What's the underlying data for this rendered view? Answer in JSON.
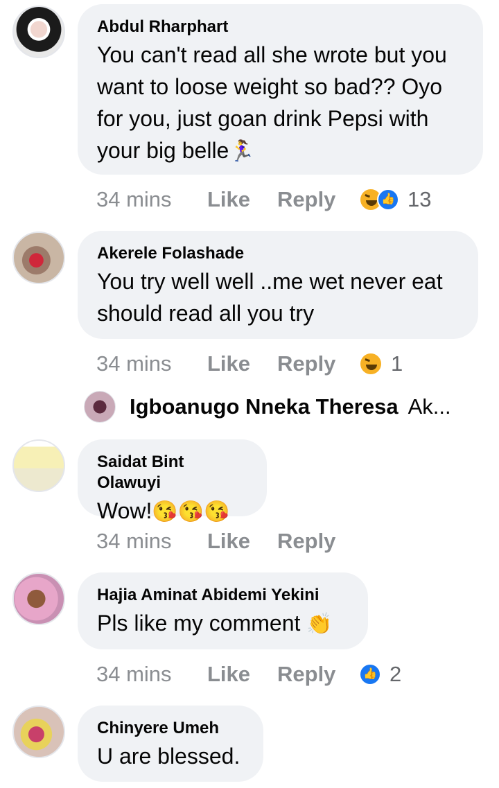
{
  "comments": [
    {
      "name": "Abdul Rharphart",
      "text": "You can't read all she wrote but you\nwant to loose weight so bad?? Oyo\nfor you, just goan drink Pepsi with\nyour big belle",
      "emoji": "🏃‍♀️",
      "time": "34 mins",
      "like": "Like",
      "reply": "Reply",
      "reaction_count": "13",
      "reactions": [
        "laugh",
        "like"
      ]
    },
    {
      "name": "Akerele Folashade",
      "text": "You try well well ..me wet never eat\nshould read all you try",
      "time": "34 mins",
      "like": "Like",
      "reply": "Reply",
      "reaction_count": "1",
      "reactions": [
        "laugh"
      ]
    },
    {
      "name": "Saidat Bint Olawuyi",
      "text": "Wow!",
      "emoji": "😘😘😘",
      "time": "34 mins",
      "like": "Like",
      "reply": "Reply"
    },
    {
      "name": "Hajia Aminat Abidemi Yekini",
      "text": "Pls like my comment",
      "emoji": "👏",
      "time": "34 mins",
      "like": "Like",
      "reply": "Reply",
      "reaction_count": "2",
      "reactions": [
        "like"
      ]
    },
    {
      "name": "Chinyere Umeh",
      "text": "U are blessed."
    }
  ],
  "reply_preview": {
    "name": "Igboanugo Nneka Theresa",
    "snippet": "Ak..."
  },
  "colors": {
    "bubble": "#f0f2f5",
    "meta_text": "#8a8d91",
    "like_blue": "#1877f2",
    "laugh_yellow": "#f7b125"
  }
}
